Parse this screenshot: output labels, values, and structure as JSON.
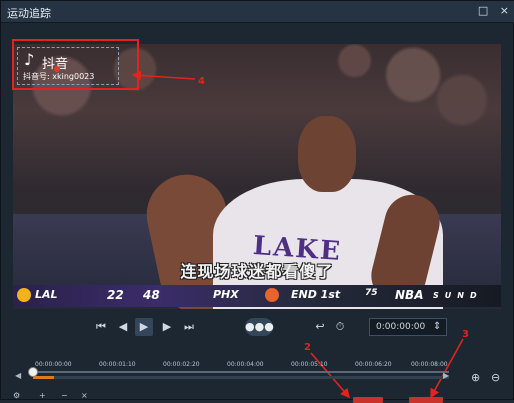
{
  "window": {
    "title": "运动追踪",
    "min_label": "□",
    "close_label": "×"
  },
  "video": {
    "watermark": {
      "logo": "♪",
      "name": "抖音",
      "id_text": "抖音号: xking0023"
    },
    "subtitle": "连现场球迷都看傻了",
    "jersey": "LAKE",
    "scoreboard": {
      "team1": "LAL",
      "score1": "22",
      "score2": "48",
      "team2": "PHX",
      "period": "END 1st",
      "anniversary": "75",
      "league": "NBA",
      "network": "SUND"
    }
  },
  "controls": {
    "first_icon": "⏮",
    "prev_icon": "◀",
    "play_icon": "▶",
    "next_icon": "▶",
    "last_icon": "⏭",
    "track_icon": "●●●",
    "return_icon": "↩",
    "timer_icon": "⏱",
    "timecode": "0:00:00:00",
    "timecode_spin": "⇕"
  },
  "timeline": {
    "ticks": [
      "00:00:00:00",
      "00:00:01:10",
      "00:00:02:20",
      "00:00:04:00",
      "00:00:05:10",
      "00:00:06:20",
      "00:00:08:00"
    ],
    "scroll_left": "◀",
    "scroll_right": "▶",
    "progress_fraction": 0.05,
    "zoom_in": "⊕",
    "zoom_out": "⊖"
  },
  "annotations": {
    "n2": "2",
    "n3": "3",
    "n4": "4"
  },
  "colors": {
    "accent": "#e07b1c",
    "annotation_red": "#e2241c"
  }
}
